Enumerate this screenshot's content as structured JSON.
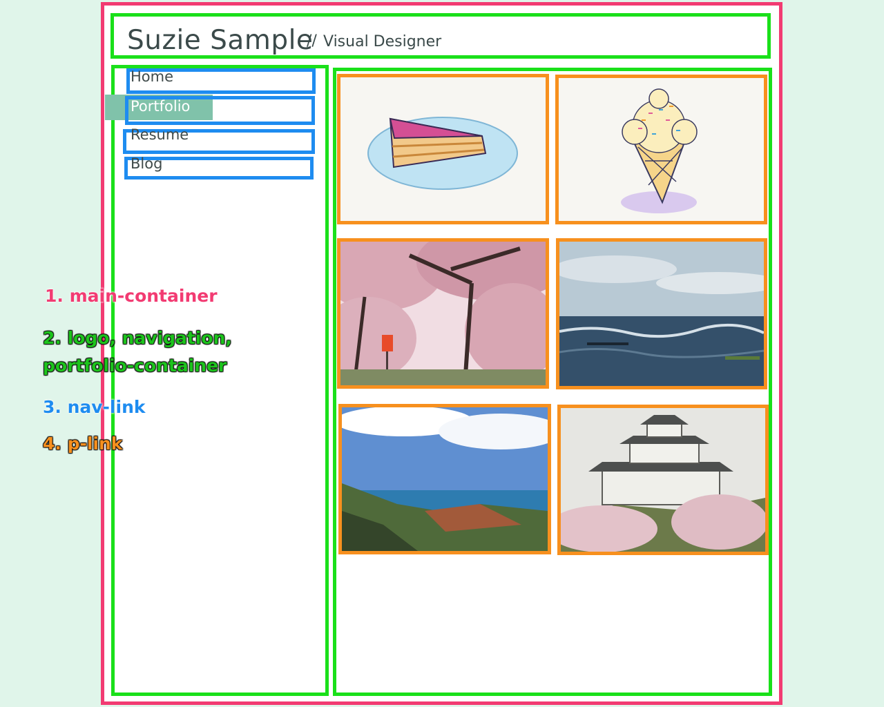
{
  "logo": {
    "name": "Suzie Sample",
    "separator": "//",
    "role": "Visual Designer"
  },
  "navigation": {
    "links": [
      {
        "label": "Home",
        "active": false
      },
      {
        "label": "Portfolio",
        "active": true
      },
      {
        "label": "Resume",
        "active": false
      },
      {
        "label": "Blog",
        "active": false
      }
    ]
  },
  "portfolio": {
    "items": [
      {
        "subject": "cake-slice-sketch"
      },
      {
        "subject": "ice-cream-cone-sketch"
      },
      {
        "subject": "cherry-blossoms-photo"
      },
      {
        "subject": "ocean-kayakers-photo"
      },
      {
        "subject": "coastal-valley-photo"
      },
      {
        "subject": "japanese-castle-photo"
      }
    ]
  },
  "legend": {
    "item1": "1. main-container",
    "item2_line1": "2. logo, navigation,",
    "item2_line2": "portfolio-container",
    "item3": "3. nav-link",
    "item4": "4. p-link"
  },
  "colors": {
    "page_background": "#e0f5ea",
    "main_container": "#f23b72",
    "container_outline": "#1ae01a",
    "nav_link_outline": "#1e8cf0",
    "p_link_outline": "#f7901e",
    "active_nav_background": "#80c2aa"
  }
}
